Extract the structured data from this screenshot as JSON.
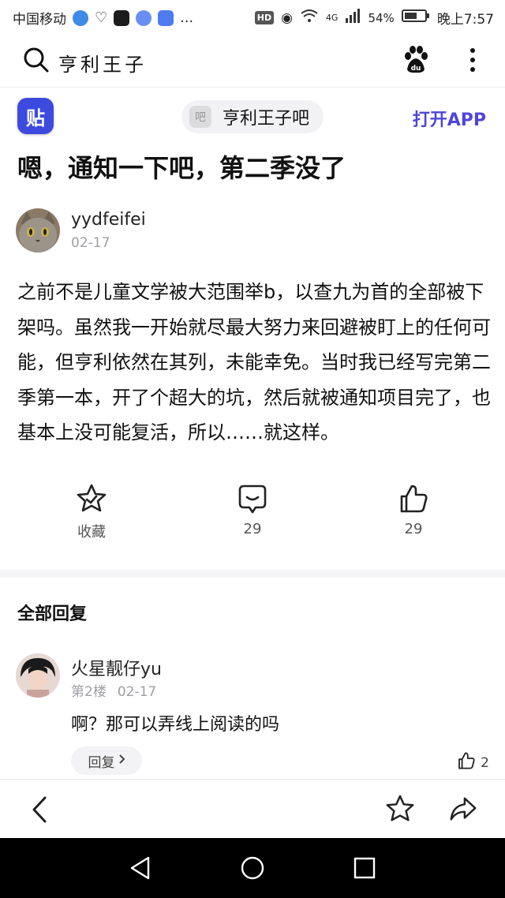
{
  "status_bar": {
    "carrier": "中国移动",
    "network": "4G",
    "battery": "54%",
    "time": "晚上7:57",
    "hd_badge": "HD",
    "more": "…",
    "colors": {
      "app1": "#3f8be6",
      "app2": "#1c1c1c",
      "app3": "#6a8ff2",
      "app4": "#4f7bf0"
    }
  },
  "search": {
    "query": "亨利王子"
  },
  "forum_bar": {
    "logo_text": "贴",
    "forum_icon_text": "吧",
    "forum_name": "亨利王子吧",
    "open_app": "打开APP"
  },
  "post": {
    "title": "嗯，通知一下吧，第二季没了",
    "author": "yydfeifei",
    "date": "02-17",
    "content": "之前不是儿童文学被大范围举b，以查九为首的全部被下架吗。虽然我一开始就尽最大努力来回避被盯上的任何可能，但亨利依然在其列，未能幸免。当时我已经写完第二季第一本，开了个超大的坑，然后就被通知项目完了，也基本上没可能复活，所以……就这样。"
  },
  "actions": {
    "collect": "收藏",
    "comments": "29",
    "likes": "29"
  },
  "replies_section": {
    "header": "全部回复",
    "items": [
      {
        "author": "火星靓仔yu",
        "floor": "第2楼",
        "date": "02-17",
        "text": "啊？那可以弄线上阅读的吗",
        "reply_button": "回复",
        "likes": "2"
      }
    ]
  }
}
